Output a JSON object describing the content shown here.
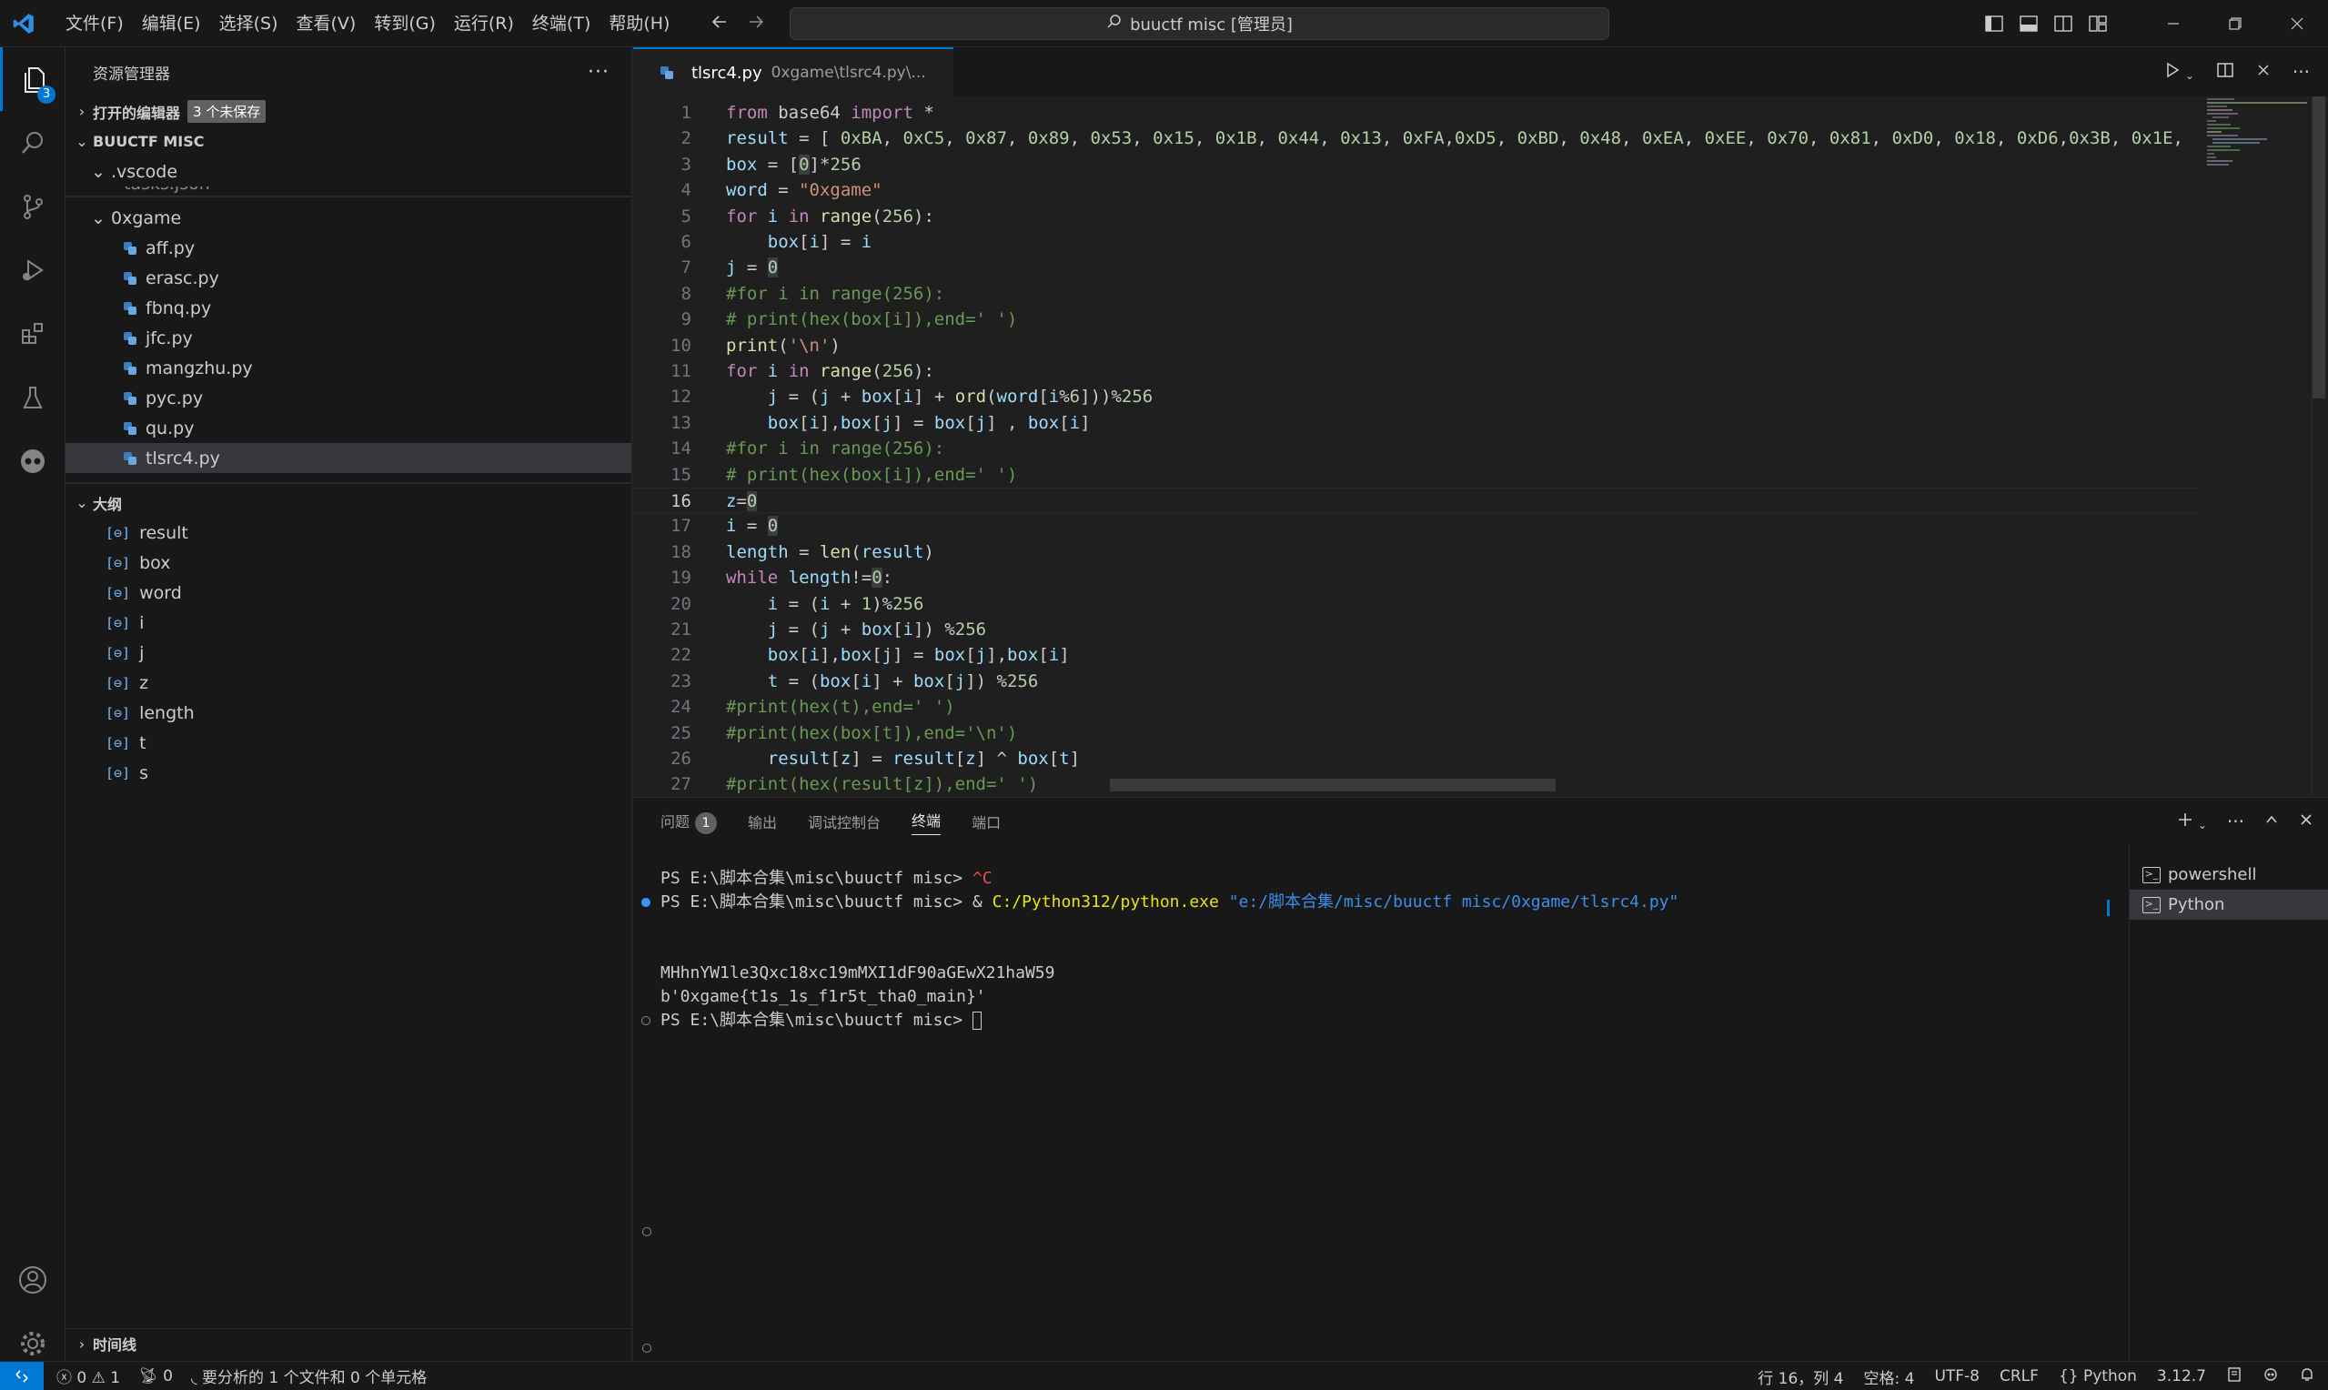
{
  "menu": [
    "文件(F)",
    "编辑(E)",
    "选择(S)",
    "查看(V)",
    "转到(G)",
    "运行(R)",
    "终端(T)",
    "帮助(H)"
  ],
  "command_center": "buuctf misc [管理员]",
  "activity_badge": "3",
  "sidebar": {
    "title": "资源管理器",
    "open_editors": "打开的编辑器",
    "unsaved": "3 个未保存",
    "workspace": "BUUCTF MISC",
    "vscode_folder": ".vscode",
    "tasks_partial": "tasks.json",
    "folder": "0xgame",
    "files": [
      "aff.py",
      "erasc.py",
      "fbnq.py",
      "jfc.py",
      "mangzhu.py",
      "pyc.py",
      "qu.py",
      "tlsrc4.py"
    ],
    "outline_title": "大纲",
    "outline": [
      "result",
      "box",
      "word",
      "i",
      "j",
      "z",
      "length",
      "t",
      "s"
    ],
    "timeline": "时间线"
  },
  "editor": {
    "tab_name": "tlsrc4.py",
    "tab_path": "0xgame\\tlsrc4.py\\...",
    "current_line": 16,
    "lines": [
      {
        "n": "1",
        "html": "<span class='kw'>from</span> base64 <span class='kw'>import</span> *"
      },
      {
        "n": "2",
        "html": "<span class='var'>result</span> = [ <span class='num'>0xBA</span>, <span class='num'>0xC5</span>, <span class='num'>0x87</span>, <span class='num'>0x89</span>, <span class='num'>0x53</span>, <span class='num'>0x15</span>, <span class='num'>0x1B</span>, <span class='num'>0x44</span>, <span class='num'>0x13</span>, <span class='num'>0xFA</span>,<span class='num'>0xD5</span>, <span class='num'>0xBD</span>, <span class='num'>0x48</span>, <span class='num'>0xEA</span>, <span class='num'>0xEE</span>, <span class='num'>0x70</span>, <span class='num'>0x81</span>, <span class='num'>0xD0</span>, <span class='num'>0x18</span>, <span class='num'>0xD6</span>,<span class='num'>0x3B</span>, <span class='num'>0x1E</span>,"
      },
      {
        "n": "3",
        "html": "<span class='var'>box</span> = [<span class='num hl'>0</span>]*<span class='num'>256</span>"
      },
      {
        "n": "4",
        "html": "<span class='var'>word</span> = <span class='str'>\"0xgame\"</span>"
      },
      {
        "n": "5",
        "html": "<span class='kw'>for</span> <span class='var'>i</span> <span class='kw'>in</span> <span class='fn'>range</span>(<span class='num'>256</span>):"
      },
      {
        "n": "6",
        "html": "    <span class='var'>box</span>[<span class='var'>i</span>] = <span class='var'>i</span>"
      },
      {
        "n": "7",
        "html": "<span class='var'>j</span> = <span class='num hl'>0</span>"
      },
      {
        "n": "8",
        "html": "<span class='com'>#for i in range(256):</span>"
      },
      {
        "n": "9",
        "html": "<span class='com'># print(hex(box[i]),end=' ')</span>"
      },
      {
        "n": "10",
        "html": "<span class='fn'>print</span>(<span class='str'>'\\n'</span>)"
      },
      {
        "n": "11",
        "html": "<span class='kw'>for</span> <span class='var'>i</span> <span class='kw'>in</span> <span class='fn'>range</span>(<span class='num'>256</span>):"
      },
      {
        "n": "12",
        "html": "    <span class='var'>j</span> = (<span class='var'>j</span> + <span class='var'>box</span>[<span class='var'>i</span>] + <span class='fn'>ord</span>(<span class='var'>word</span>[<span class='var'>i</span>%<span class='num'>6</span>]))%<span class='num'>256</span>"
      },
      {
        "n": "13",
        "html": "    <span class='var'>box</span>[<span class='var'>i</span>],<span class='var'>box</span>[<span class='var'>j</span>] = <span class='var'>box</span>[<span class='var'>j</span>] , <span class='var'>box</span>[<span class='var'>i</span>]"
      },
      {
        "n": "14",
        "html": "<span class='com'>#for i in range(256):</span>"
      },
      {
        "n": "15",
        "html": "<span class='com'># print(hex(box[i]),end=' ')</span>"
      },
      {
        "n": "16",
        "html": "<span class='var'>z</span>=<span class='num hl'>0</span>"
      },
      {
        "n": "17",
        "html": "<span class='var'>i</span> = <span class='num hl'>0</span>"
      },
      {
        "n": "18",
        "html": "<span class='var'>length</span> = <span class='fn'>len</span>(<span class='var'>result</span>)"
      },
      {
        "n": "19",
        "html": "<span class='kw'>while</span> <span class='var'>length</span>!=<span class='num hl'>0</span>:"
      },
      {
        "n": "20",
        "html": "    <span class='var'>i</span> = (<span class='var'>i</span> + <span class='num'>1</span>)%<span class='num'>256</span>"
      },
      {
        "n": "21",
        "html": "    <span class='var'>j</span> = (<span class='var'>j</span> + <span class='var'>box</span>[<span class='var'>i</span>]) %<span class='num'>256</span>"
      },
      {
        "n": "22",
        "html": "    <span class='var'>box</span>[<span class='var'>i</span>],<span class='var'>box</span>[<span class='var'>j</span>] = <span class='var'>box</span>[<span class='var'>j</span>],<span class='var'>box</span>[<span class='var'>i</span>]"
      },
      {
        "n": "23",
        "html": "    <span class='var'>t</span> = (<span class='var'>box</span>[<span class='var'>i</span>] + <span class='var'>box</span>[<span class='var'>j</span>]) %<span class='num'>256</span>"
      },
      {
        "n": "24",
        "html": "<span class='com'>#print(hex(t),end=' ')</span>"
      },
      {
        "n": "25",
        "html": "<span class='com'>#print(hex(box[t]),end='\\n')</span>"
      },
      {
        "n": "26",
        "html": "    <span class='var'>result</span>[<span class='var'>z</span>] = <span class='var'>result</span>[<span class='var'>z</span>] ^ <span class='var'>box</span>[<span class='var'>t</span>]"
      },
      {
        "n": "27",
        "html": "<span class='com'>#print(hex(result[z]),end=' ')</span>"
      }
    ]
  },
  "panel": {
    "tabs": [
      "问题",
      "输出",
      "调试控制台",
      "终端",
      "端口"
    ],
    "problems_count": "1",
    "terminal_lines": [
      {
        "dot": "",
        "html": "PS E:\\脚本合集\\misc\\buuctf misc> <span style='color:#f14c4c'>^C</span>"
      },
      {
        "dot": "blue",
        "html": "PS E:\\脚本合集\\misc\\buuctf misc> &amp; <span style='color:#e5e510'>C:/Python312/python.exe</span> <span style='color:#3b8eea'>\"e:/脚本合集/misc/buuctf misc/0xgame/tlsrc4.py\"</span>"
      },
      {
        "dot": "",
        "html": ""
      },
      {
        "dot": "",
        "html": ""
      },
      {
        "dot": "",
        "html": "MHhnYW1le3Qxc18xc19mMXI1dF90aGEwX21haW59"
      },
      {
        "dot": "",
        "html": "b'0xgame{t1s_1s_f1r5t_tha0_main}'"
      },
      {
        "dot": "hollow",
        "html": "PS E:\\脚本合集\\misc\\buuctf misc> <span style='display:inline-block;width:10px;height:20px;border:1px solid #cccccc;vertical-align:middle'></span>"
      }
    ],
    "terminals": [
      "powershell",
      "Python"
    ]
  },
  "statusbar": {
    "errors": "0",
    "warnings": "1",
    "ports": "0",
    "analysis": "要分析的 1 个文件和 0 个单元格",
    "position": "行 16，列 4",
    "spaces": "空格: 4",
    "encoding": "UTF-8",
    "eol": "CRLF",
    "language": "Python",
    "python_version": "3.12.7"
  }
}
